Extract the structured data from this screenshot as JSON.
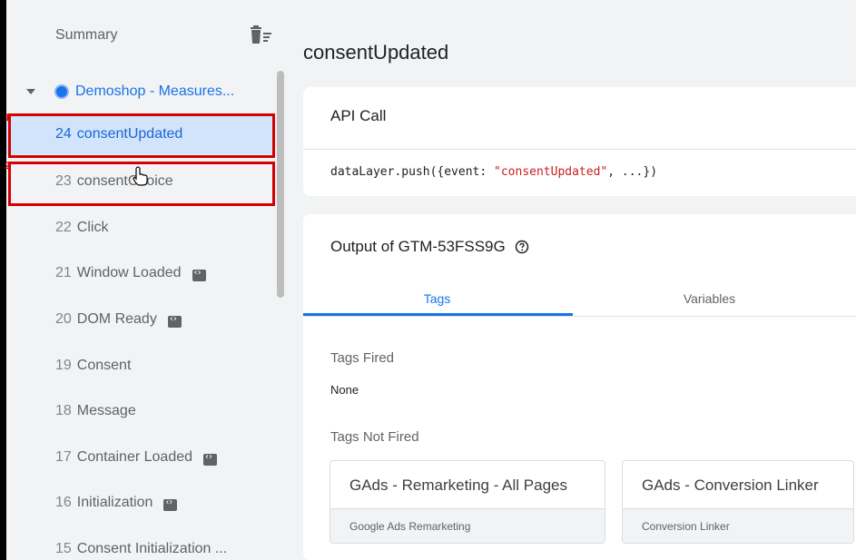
{
  "sidebar": {
    "header": "Summary",
    "container": "Demoshop - Measures...",
    "events": [
      {
        "num": "24",
        "label": "consentUpdated",
        "badge": false,
        "selected": true
      },
      {
        "num": "23",
        "label": "consentChoice",
        "badge": false,
        "selected": false
      },
      {
        "num": "22",
        "label": "Click",
        "badge": false,
        "selected": false
      },
      {
        "num": "21",
        "label": "Window Loaded",
        "badge": true,
        "selected": false
      },
      {
        "num": "20",
        "label": "DOM Ready",
        "badge": true,
        "selected": false
      },
      {
        "num": "19",
        "label": "Consent",
        "badge": false,
        "selected": false
      },
      {
        "num": "18",
        "label": "Message",
        "badge": false,
        "selected": false
      },
      {
        "num": "17",
        "label": "Container Loaded",
        "badge": true,
        "selected": false
      },
      {
        "num": "16",
        "label": "Initialization",
        "badge": true,
        "selected": false
      },
      {
        "num": "15",
        "label": "Consent Initialization ...",
        "badge": false,
        "selected": false
      }
    ],
    "annotations": [
      "1",
      "2"
    ]
  },
  "main": {
    "title": "consentUpdated",
    "api_card": {
      "title": "API Call",
      "code_prefix": "dataLayer.push({event: ",
      "code_string": "\"consentUpdated\"",
      "code_suffix": ", ...})"
    },
    "output_card": {
      "title": "Output of GTM-53FSS9G",
      "tabs": [
        "Tags",
        "Variables"
      ],
      "tags_fired_label": "Tags Fired",
      "tags_fired_value": "None",
      "tags_not_fired_label": "Tags Not Fired",
      "tags_not_fired": [
        {
          "name": "GAds - Remarketing - All Pages",
          "type": "Google Ads Remarketing"
        },
        {
          "name": "GAds - Conversion Linker",
          "type": "Conversion Linker"
        }
      ]
    }
  },
  "colors": {
    "accent": "#1a73e8",
    "selected_bg": "#d2e3fc",
    "annotation": "#d50000",
    "code_string": "#c5221f"
  }
}
